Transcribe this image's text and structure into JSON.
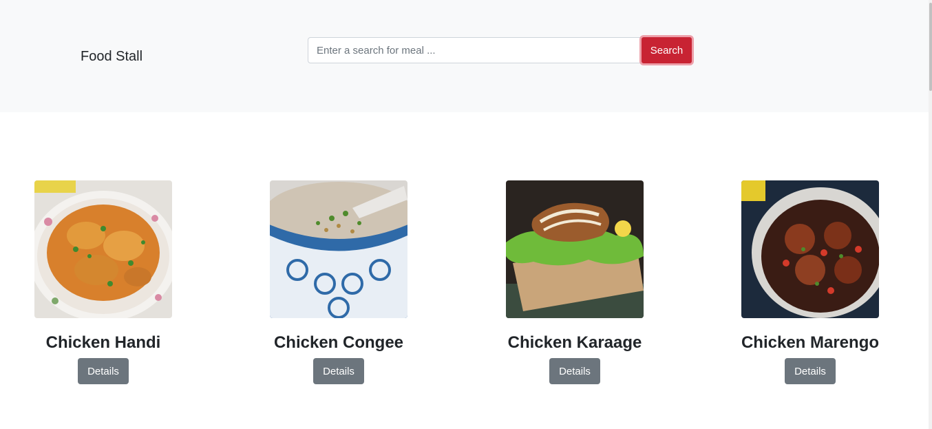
{
  "header": {
    "brand": "Food Stall",
    "search_placeholder": "Enter a search for meal ...",
    "search_value": "",
    "search_label": "Search"
  },
  "meals": [
    {
      "name": "Chicken Handi",
      "button_label": "Details",
      "image": "chicken-handi-photo"
    },
    {
      "name": "Chicken Congee",
      "button_label": "Details",
      "image": "chicken-congee-photo"
    },
    {
      "name": "Chicken Karaage",
      "button_label": "Details",
      "image": "chicken-karaage-photo"
    },
    {
      "name": "Chicken Marengo",
      "button_label": "Details",
      "image": "chicken-marengo-photo"
    }
  ],
  "colors": {
    "header_bg": "#f8f9fa",
    "search_button": "#c82333",
    "details_button": "#6c757d"
  }
}
